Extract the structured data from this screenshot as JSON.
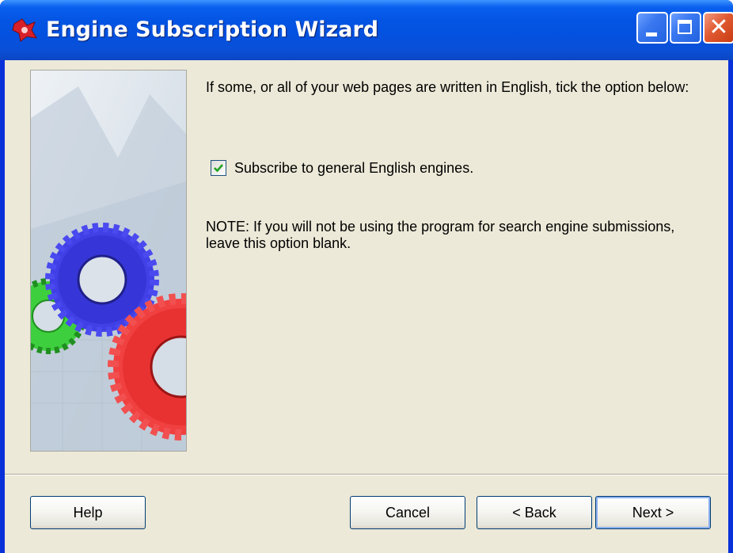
{
  "window": {
    "title": "Engine Subscription Wizard",
    "icons": {
      "app": "wizard-app-icon",
      "minimize": "minimize-icon",
      "maximize": "maximize-icon",
      "close": "close-icon"
    },
    "close_glyph": "✕"
  },
  "content": {
    "intro": "If some, or all of your web pages are written in English, tick the option below:",
    "checkbox": {
      "label": "Subscribe to general English engines.",
      "checked": true
    },
    "note": "NOTE: If you will not be using the program for search engine submissions, leave this option blank."
  },
  "buttons": {
    "help": "Help",
    "cancel": "Cancel",
    "back": "< Back",
    "next": "Next >"
  },
  "colors": {
    "titlebar": "#0454e3",
    "client_bg": "#ece9d8",
    "gear_blue": "#3a3ae0",
    "gear_red": "#ee3a3a",
    "gear_green": "#3ecf3e",
    "checkmark": "#21a121"
  }
}
